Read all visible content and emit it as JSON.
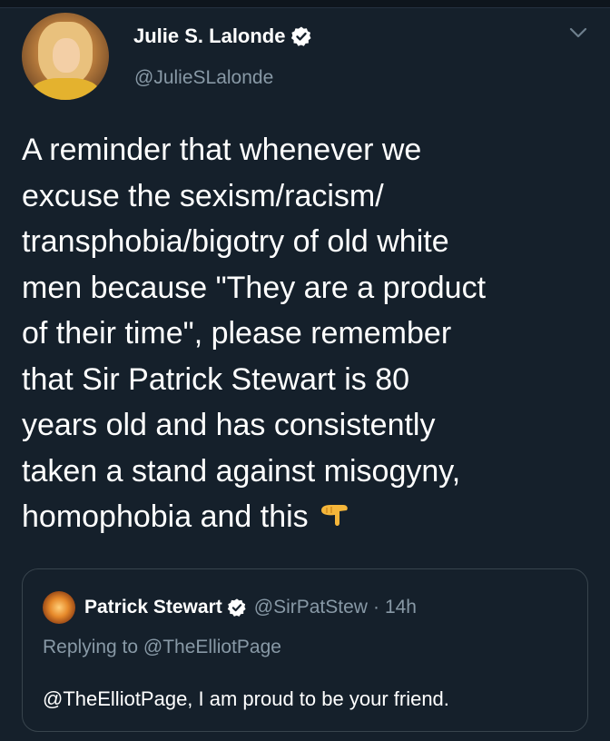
{
  "author": {
    "name": "Julie S. Lalonde",
    "handle": "@JulieSLalonde",
    "avatar_icon": "profile-photo"
  },
  "tweet": {
    "text": "A reminder that whenever we\nexcuse the sexism/racism/\ntransphobia/bigotry of old white\nmen because \"They are a product\nof their time\", please remember\nthat Sir Patrick Stewart is 80\nyears old and has consistently\ntaken a stand against misogyny,\nhomophobia and this",
    "emoji_icon": "backhand-index-pointing-down-icon"
  },
  "quoted_tweet": {
    "name": "Patrick Stewart",
    "handle": "@SirPatStew",
    "separator": "·",
    "time": "14h",
    "replying_to": "Replying to @TheElliotPage",
    "text": "@TheElliotPage, I am proud to be your friend."
  },
  "colors": {
    "background": "#15202b",
    "primary_text": "#ffffff",
    "secondary_text": "#8899a6",
    "card_border": "#38444d",
    "verified_badge": "#ffffff"
  }
}
